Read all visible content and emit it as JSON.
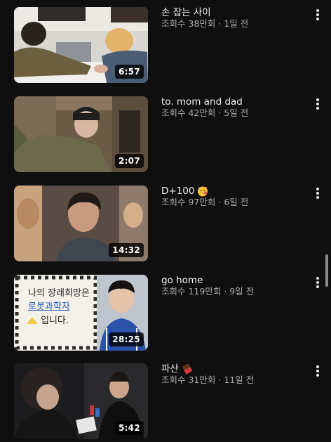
{
  "videos": [
    {
      "title": "손 잡는 사이",
      "views": "조회수 38만회",
      "age": "1일 전",
      "duration": "6:57",
      "thumb_desc": "two people at a table clasping hands"
    },
    {
      "title": "to. mom and dad",
      "views": "조회수 42만회",
      "age": "5일 전",
      "duration": "2:07",
      "thumb_desc": "person in beanie taking selfie"
    },
    {
      "title": "D+100",
      "title_emoji": "face-with-party-horn-icon",
      "views": "조회수 97만회",
      "age": "6일 전",
      "duration": "14:32",
      "thumb_desc": "smiling young man in crowd"
    },
    {
      "title": "go home",
      "views": "조회수 119만회",
      "age": "9일 전",
      "duration": "28:25",
      "thumb_desc": "child photo with sign",
      "sign_lines": [
        "나의 장래희망은",
        "로봇과학자",
        "입니다."
      ]
    },
    {
      "title": "파산",
      "title_emoji": "chocolate-bar-icon",
      "views": "조회수 31만회",
      "age": "11일 전",
      "duration": "5:42",
      "thumb_desc": "people playing cards in dark room"
    }
  ],
  "separator": " · "
}
